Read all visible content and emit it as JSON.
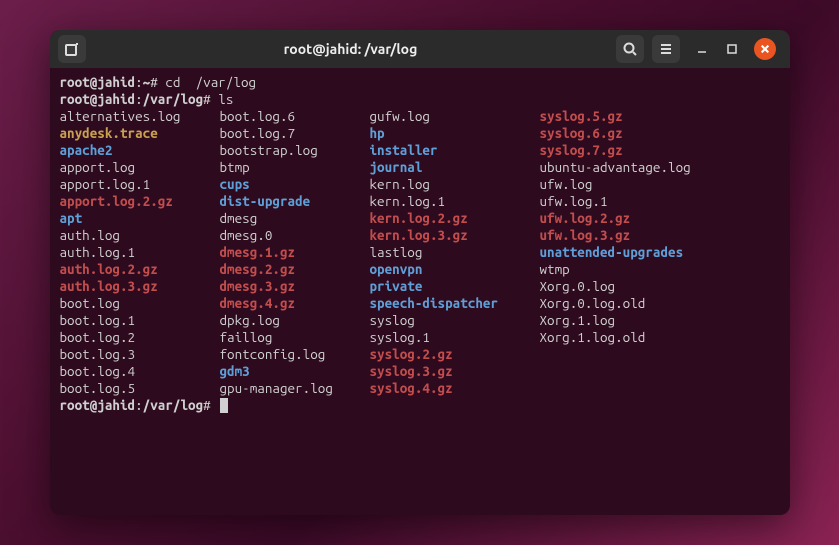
{
  "titlebar": {
    "title": "root@jahid: /var/log"
  },
  "prompt1": {
    "user_host": "root@jahid",
    "path": "~",
    "symbol": "#",
    "command": "cd  /var/log"
  },
  "prompt2": {
    "user_host": "root@jahid",
    "path": "/var/log",
    "symbol": "#",
    "command": "ls"
  },
  "prompt3": {
    "user_host": "root@jahid",
    "path": "/var/log",
    "symbol": "#",
    "command": ""
  },
  "cols": [
    [
      {
        "name": "alternatives.log",
        "cls": "f-plain"
      },
      {
        "name": "anydesk.trace",
        "cls": "f-gold"
      },
      {
        "name": "apache2",
        "cls": "f-dir"
      },
      {
        "name": "apport.log",
        "cls": "f-plain"
      },
      {
        "name": "apport.log.1",
        "cls": "f-plain"
      },
      {
        "name": "apport.log.2.gz",
        "cls": "f-gz"
      },
      {
        "name": "apt",
        "cls": "f-dir"
      },
      {
        "name": "auth.log",
        "cls": "f-plain"
      },
      {
        "name": "auth.log.1",
        "cls": "f-plain"
      },
      {
        "name": "auth.log.2.gz",
        "cls": "f-gz"
      },
      {
        "name": "auth.log.3.gz",
        "cls": "f-gz"
      },
      {
        "name": "boot.log",
        "cls": "f-plain"
      },
      {
        "name": "boot.log.1",
        "cls": "f-plain"
      },
      {
        "name": "boot.log.2",
        "cls": "f-plain"
      },
      {
        "name": "boot.log.3",
        "cls": "f-plain"
      },
      {
        "name": "boot.log.4",
        "cls": "f-plain"
      },
      {
        "name": "boot.log.5",
        "cls": "f-plain"
      }
    ],
    [
      {
        "name": "boot.log.6",
        "cls": "f-plain"
      },
      {
        "name": "boot.log.7",
        "cls": "f-plain"
      },
      {
        "name": "bootstrap.log",
        "cls": "f-plain"
      },
      {
        "name": "btmp",
        "cls": "f-plain"
      },
      {
        "name": "cups",
        "cls": "f-dir"
      },
      {
        "name": "dist-upgrade",
        "cls": "f-dir"
      },
      {
        "name": "dmesg",
        "cls": "f-plain"
      },
      {
        "name": "dmesg.0",
        "cls": "f-plain"
      },
      {
        "name": "dmesg.1.gz",
        "cls": "f-gz"
      },
      {
        "name": "dmesg.2.gz",
        "cls": "f-gz"
      },
      {
        "name": "dmesg.3.gz",
        "cls": "f-gz"
      },
      {
        "name": "dmesg.4.gz",
        "cls": "f-gz"
      },
      {
        "name": "dpkg.log",
        "cls": "f-plain"
      },
      {
        "name": "faillog",
        "cls": "f-plain"
      },
      {
        "name": "fontconfig.log",
        "cls": "f-plain"
      },
      {
        "name": "gdm3",
        "cls": "f-dir"
      },
      {
        "name": "gpu-manager.log",
        "cls": "f-plain"
      }
    ],
    [
      {
        "name": "gufw.log",
        "cls": "f-plain"
      },
      {
        "name": "hp",
        "cls": "f-dir"
      },
      {
        "name": "installer",
        "cls": "f-dir"
      },
      {
        "name": "journal",
        "cls": "f-dir"
      },
      {
        "name": "kern.log",
        "cls": "f-plain"
      },
      {
        "name": "kern.log.1",
        "cls": "f-plain"
      },
      {
        "name": "kern.log.2.gz",
        "cls": "f-gz"
      },
      {
        "name": "kern.log.3.gz",
        "cls": "f-gz"
      },
      {
        "name": "lastlog",
        "cls": "f-plain"
      },
      {
        "name": "openvpn",
        "cls": "f-dir"
      },
      {
        "name": "private",
        "cls": "f-dir"
      },
      {
        "name": "speech-dispatcher",
        "cls": "f-dir"
      },
      {
        "name": "syslog",
        "cls": "f-plain"
      },
      {
        "name": "syslog.1",
        "cls": "f-plain"
      },
      {
        "name": "syslog.2.gz",
        "cls": "f-gz"
      },
      {
        "name": "syslog.3.gz",
        "cls": "f-gz"
      },
      {
        "name": "syslog.4.gz",
        "cls": "f-gz"
      }
    ],
    [
      {
        "name": "syslog.5.gz",
        "cls": "f-gz"
      },
      {
        "name": "syslog.6.gz",
        "cls": "f-gz"
      },
      {
        "name": "syslog.7.gz",
        "cls": "f-gz"
      },
      {
        "name": "ubuntu-advantage.log",
        "cls": "f-plain"
      },
      {
        "name": "ufw.log",
        "cls": "f-plain"
      },
      {
        "name": "ufw.log.1",
        "cls": "f-plain"
      },
      {
        "name": "ufw.log.2.gz",
        "cls": "f-gz"
      },
      {
        "name": "ufw.log.3.gz",
        "cls": "f-gz"
      },
      {
        "name": "unattended-upgrades",
        "cls": "f-dir"
      },
      {
        "name": "wtmp",
        "cls": "f-plain"
      },
      {
        "name": "Xorg.0.log",
        "cls": "f-plain"
      },
      {
        "name": "Xorg.0.log.old",
        "cls": "f-plain"
      },
      {
        "name": "Xorg.1.log",
        "cls": "f-plain"
      },
      {
        "name": "Xorg.1.log.old",
        "cls": "f-plain"
      }
    ]
  ]
}
